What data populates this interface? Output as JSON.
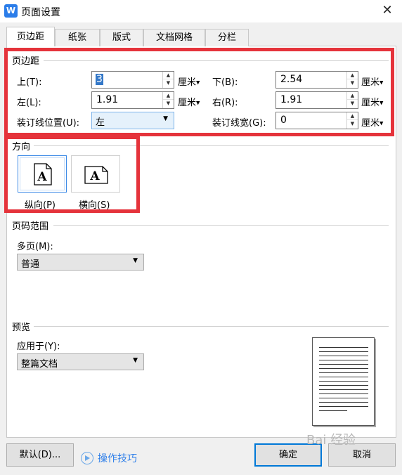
{
  "window": {
    "title": "页面设置",
    "app_icon_glyph": "W",
    "accent_color": "#2b7de9",
    "highlight_color": "#e5333b"
  },
  "tabs": [
    {
      "label": "页边距",
      "active": true
    },
    {
      "label": "纸张",
      "active": false
    },
    {
      "label": "版式",
      "active": false
    },
    {
      "label": "文档网格",
      "active": false
    },
    {
      "label": "分栏",
      "active": false
    }
  ],
  "margins": {
    "section_title": "页边距",
    "top": {
      "label": "上(T):",
      "value": "3",
      "unit": "厘米"
    },
    "bottom": {
      "label": "下(B):",
      "value": "2.54",
      "unit": "厘米"
    },
    "left": {
      "label": "左(L):",
      "value": "1.91",
      "unit": "厘米"
    },
    "right": {
      "label": "右(R):",
      "value": "1.91",
      "unit": "厘米"
    },
    "gutter_position": {
      "label": "装订线位置(U):",
      "value": "左"
    },
    "gutter_width": {
      "label": "装订线宽(G):",
      "value": "0",
      "unit": "厘米"
    }
  },
  "orientation": {
    "section_title": "方向",
    "portrait": {
      "label": "纵向(P)",
      "glyph": "A",
      "selected": true
    },
    "landscape": {
      "label": "横向(S)",
      "glyph": "A",
      "selected": false
    }
  },
  "page_range": {
    "section_title": "页码范围",
    "multi_label": "多页(M):",
    "multi_value": "普通"
  },
  "preview": {
    "section_title": "预览",
    "apply_label": "应用于(Y):",
    "apply_value": "整篇文档"
  },
  "footer": {
    "default_button": "默认(D)...",
    "tips_link": "操作技巧",
    "ok_button": "确定",
    "cancel_button": "取消",
    "watermark_text": "Bai 经验"
  },
  "icons": [
    "app-icon",
    "close-icon",
    "spin-up-icon",
    "spin-down-icon",
    "dropdown-arrow-icon",
    "portrait-page-icon",
    "landscape-page-icon",
    "play-circle-icon"
  ]
}
